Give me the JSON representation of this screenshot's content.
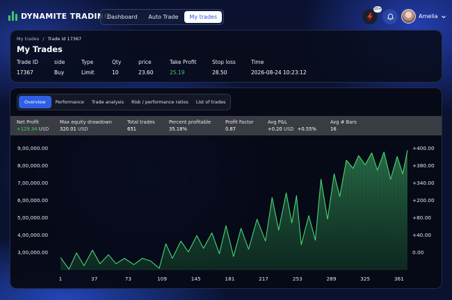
{
  "app": {
    "name": "DYNAMITE TRADING"
  },
  "nav": {
    "items": [
      {
        "label": "Dashboard",
        "active": false
      },
      {
        "label": "Auto Trade",
        "active": false
      },
      {
        "label": "My trades",
        "active": true
      }
    ]
  },
  "header": {
    "notification_badge": "10+",
    "user_name": "Amelia"
  },
  "breadcrumb": {
    "parent": "My trades",
    "separator": "/",
    "current": "Trade id 17367"
  },
  "page_title": "My Trades",
  "trade": {
    "headers": [
      "Trade ID",
      "side",
      "Type",
      "Qty",
      "price",
      "Take Profit",
      "Stop loss",
      "Time"
    ],
    "values": [
      "17367",
      "Buy",
      "Limit",
      "10",
      "23.60",
      "25.19",
      "28.50",
      "2026-08-24 10:23:12"
    ]
  },
  "tabs": [
    {
      "label": "Overview",
      "active": true
    },
    {
      "label": "Performance",
      "active": false
    },
    {
      "label": "Trade analysis",
      "active": false
    },
    {
      "label": "Risk / performance ratios",
      "active": false
    },
    {
      "label": "List of trades",
      "active": false
    }
  ],
  "stats": {
    "net_profit": {
      "label": "Net Profit",
      "value": "+129.34",
      "unit": "USD"
    },
    "max_drawdown": {
      "label": "Max equity drawdown",
      "value": "320.01",
      "unit": "USD"
    },
    "total_trades": {
      "label": "Total trades",
      "value": "651"
    },
    "percent_profitable": {
      "label": "Percent profitable",
      "value": "35.18%"
    },
    "profit_factor": {
      "label": "Profit Factor",
      "value": "0.87"
    },
    "avg_pl": {
      "label": "Avg P&L",
      "value": "+0.20",
      "unit": "USD",
      "extra": "+0.55%"
    },
    "avg_bars": {
      "label": "Avg # Bars",
      "value": "16"
    }
  },
  "colors": {
    "accent": "#2f5fe6",
    "positive": "#3ed26c",
    "chart_line": "#46d873"
  },
  "chart_data": {
    "type": "area",
    "title": "",
    "xlabel": "",
    "ylabel": "",
    "x_ticks": [
      "1",
      "37",
      "73",
      "109",
      "145",
      "181",
      "217",
      "253",
      "289",
      "325",
      "361"
    ],
    "y_left_ticks": [
      "9,00,000.00",
      "8,00,000.00",
      "7,00,000.00",
      "6,00,000.00",
      "5,00,000.00",
      "4,00,000.00",
      "3,00,000.00"
    ],
    "y_right_ticks": [
      "+400.00",
      "+380.00",
      "+340.00",
      "+200.00",
      "+80.00",
      "+40.00",
      "0.00"
    ],
    "ylim": [
      2200000,
      9000000
    ],
    "xlim": [
      1,
      370
    ],
    "grid": false,
    "series": [
      {
        "values": [
          [
            1,
            2900000
          ],
          [
            10,
            2250000
          ],
          [
            18,
            3150000
          ],
          [
            26,
            2450000
          ],
          [
            35,
            3300000
          ],
          [
            43,
            2550000
          ],
          [
            52,
            3050000
          ],
          [
            60,
            2550000
          ],
          [
            69,
            2850000
          ],
          [
            79,
            2500000
          ],
          [
            88,
            2850000
          ],
          [
            97,
            2700000
          ],
          [
            106,
            2300000
          ],
          [
            113,
            3650000
          ],
          [
            120,
            2850000
          ],
          [
            129,
            3800000
          ],
          [
            137,
            3200000
          ],
          [
            146,
            4100000
          ],
          [
            153,
            3400000
          ],
          [
            162,
            4250000
          ],
          [
            170,
            3100000
          ],
          [
            177,
            4650000
          ],
          [
            185,
            2950000
          ],
          [
            193,
            4500000
          ],
          [
            201,
            3350000
          ],
          [
            210,
            5000000
          ],
          [
            219,
            3800000
          ],
          [
            226,
            6200000
          ],
          [
            233,
            4400000
          ],
          [
            241,
            6450000
          ],
          [
            247,
            4800000
          ],
          [
            252,
            6300000
          ],
          [
            257,
            3600000
          ],
          [
            265,
            5200000
          ],
          [
            272,
            3850000
          ],
          [
            278,
            7200000
          ],
          [
            285,
            5000000
          ],
          [
            292,
            7500000
          ],
          [
            298,
            6250000
          ],
          [
            305,
            8250000
          ],
          [
            312,
            7800000
          ],
          [
            318,
            8500000
          ],
          [
            325,
            8000000
          ],
          [
            332,
            8650000
          ],
          [
            338,
            7700000
          ],
          [
            345,
            8700000
          ],
          [
            352,
            7200000
          ],
          [
            359,
            8450000
          ],
          [
            365,
            7500000
          ],
          [
            370,
            8800000
          ]
        ]
      }
    ]
  }
}
